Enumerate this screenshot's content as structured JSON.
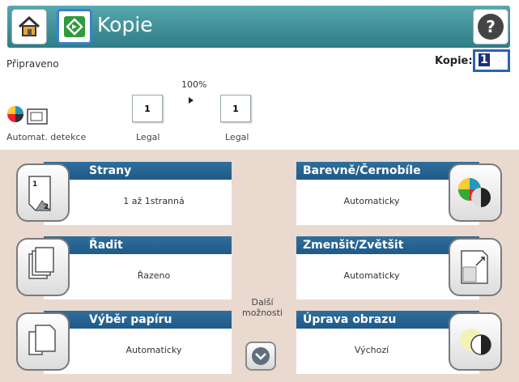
{
  "header": {
    "title": "Kopie",
    "icons": [
      "home-icon",
      "copy-app-icon",
      "help-icon"
    ]
  },
  "status": {
    "text": "Připraveno",
    "copies_label": "Kopie:",
    "copies_value": "1",
    "zoom": "100%",
    "input_paper_count": "1",
    "output_paper_count": "1",
    "auto_detect_label": "Automat. detekce",
    "input_paper_label": "Legal",
    "output_paper_label": "Legal"
  },
  "options": {
    "sides": {
      "label": "Strany",
      "value": "1 až 1stranná",
      "icon": "sides-icon"
    },
    "collate": {
      "label": "Řadit",
      "value": "Řazeno",
      "icon": "collate-icon"
    },
    "paper": {
      "label": "Výběr papíru",
      "value": "Automaticky",
      "icon": "paper-select-icon"
    },
    "color": {
      "label": "Barevně/Černobíle",
      "value": "Automaticky",
      "icon": "color-icon"
    },
    "reduce": {
      "label": "Zmenšit/Zvětšit",
      "value": "Automaticky",
      "icon": "reduce-enlarge-icon"
    },
    "image": {
      "label": "Úprava obrazu",
      "value": "Výchozí",
      "icon": "image-adjust-icon"
    }
  },
  "more": {
    "label_line1": "Další",
    "label_line2": "možnosti",
    "icon": "chevron-down-icon"
  },
  "colors": {
    "title_bar": "#3a8c95",
    "card_header": "#1f5a88",
    "panel_bg": "#e9d9cf",
    "copies_border": "#2a62b8"
  }
}
